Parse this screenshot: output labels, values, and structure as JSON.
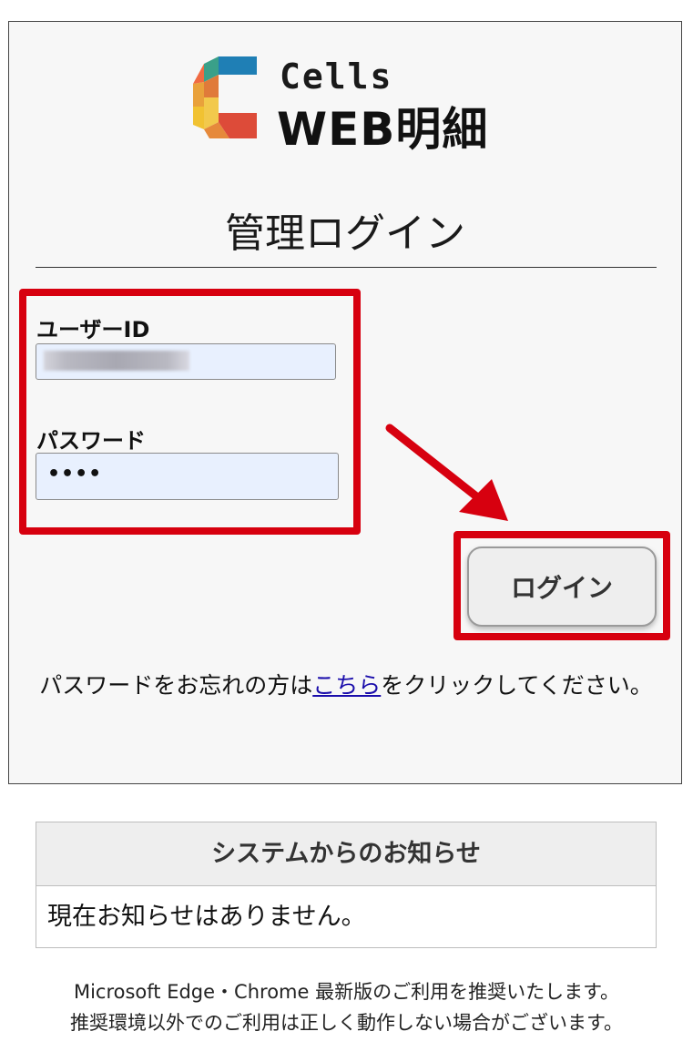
{
  "logo": {
    "brand_top": "Cells",
    "brand_main": "WEB明細"
  },
  "page": {
    "title": "管理ログイン"
  },
  "form": {
    "user_id_label": "ユーザーID",
    "password_label": "パスワード",
    "password_mask": "••••",
    "login_button": "ログイン"
  },
  "forgot": {
    "prefix": "パスワードをお忘れの方は",
    "link": "こちら",
    "suffix": "をクリックしてください。"
  },
  "notice": {
    "header": "システムからのお知らせ",
    "body": "現在お知らせはありません。"
  },
  "footer": {
    "line1": "Microsoft Edge・Chrome 最新版のご利用を推奨いたします。",
    "line2": "推奨環境以外でのご利用は正しく動作しない場合がございます。"
  },
  "colors": {
    "highlight": "#d7000f",
    "input_bg": "#e8f0fe",
    "link": "#1a0dab"
  }
}
